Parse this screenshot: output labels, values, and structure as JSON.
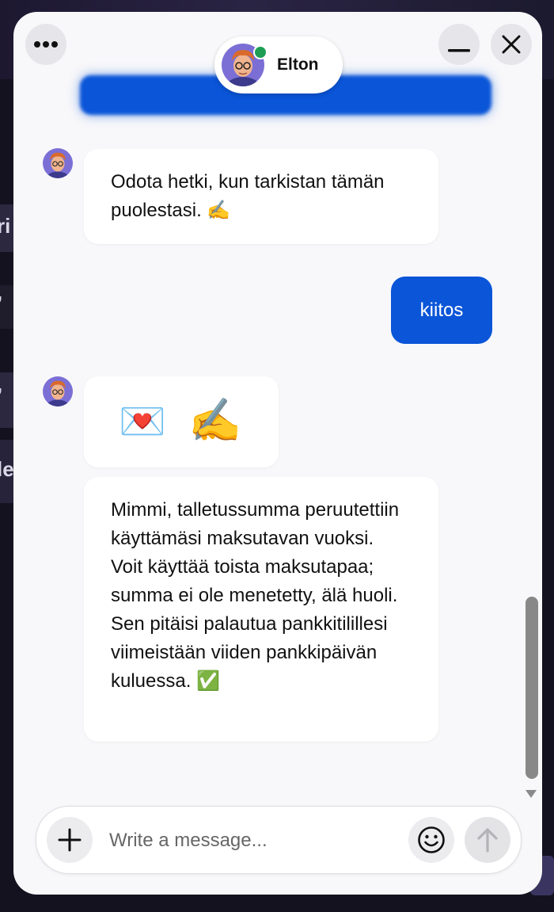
{
  "header": {
    "agent_name": "Elton",
    "agent_status": "online",
    "menu_icon": "more-dots-icon",
    "minimize_icon": "minimize-icon",
    "close_icon": "close-icon"
  },
  "messages": [
    {
      "sender": "agent",
      "text": "Odota hetki, kun tarkistan tämän puolestasi.",
      "emoji": "✍️"
    },
    {
      "sender": "user",
      "text": "kiitos"
    },
    {
      "sender": "agent",
      "type": "sticker",
      "emoji": [
        "💌",
        "✍️"
      ]
    },
    {
      "sender": "agent",
      "text": "Mimmi, talletussumma peruutettiin käyttämäsi maksutavan vuoksi. Voit käyttää toista maksutapaa; summa ei ole menetetty, älä huoli. Sen pitäisi palautua pankkitilillesi viimeistään viiden pankkipäivän kuluessa.",
      "emoji": "✅"
    }
  ],
  "composer": {
    "placeholder": "Write a message...",
    "value": "",
    "add_icon": "plus-icon",
    "emoji_icon": "smiley-icon",
    "send_icon": "send-arrow-up-icon"
  },
  "background": {
    "fragments": [
      "ri",
      "’",
      "’",
      "le"
    ]
  },
  "colors": {
    "accent": "#0a55d8",
    "online": "#1e9e55",
    "panel": "#f8f8fa"
  }
}
